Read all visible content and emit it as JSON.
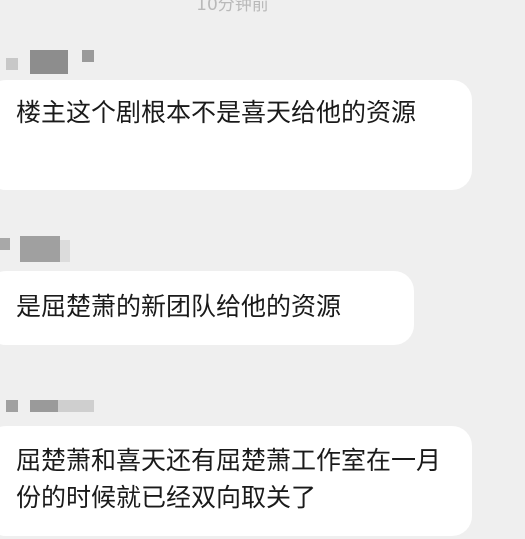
{
  "conversation": {
    "timestamp": "10分钟前",
    "messages": [
      {
        "sender_name_obscured": true,
        "text": "楼主这个剧根本不是喜天给他的资源"
      },
      {
        "sender_name_obscured": true,
        "text": "是屈楚萧的新团队给他的资源"
      },
      {
        "sender_name_obscured": true,
        "text": "屈楚萧和喜天还有屈楚萧工作室在一月份的时候就已经双向取关了"
      }
    ]
  },
  "colors": {
    "background": "#efefef",
    "bubble": "#ffffff",
    "text": "#1a1a1a",
    "timestamp": "#b9b9b9",
    "mosaic": "#bdbdbd"
  }
}
